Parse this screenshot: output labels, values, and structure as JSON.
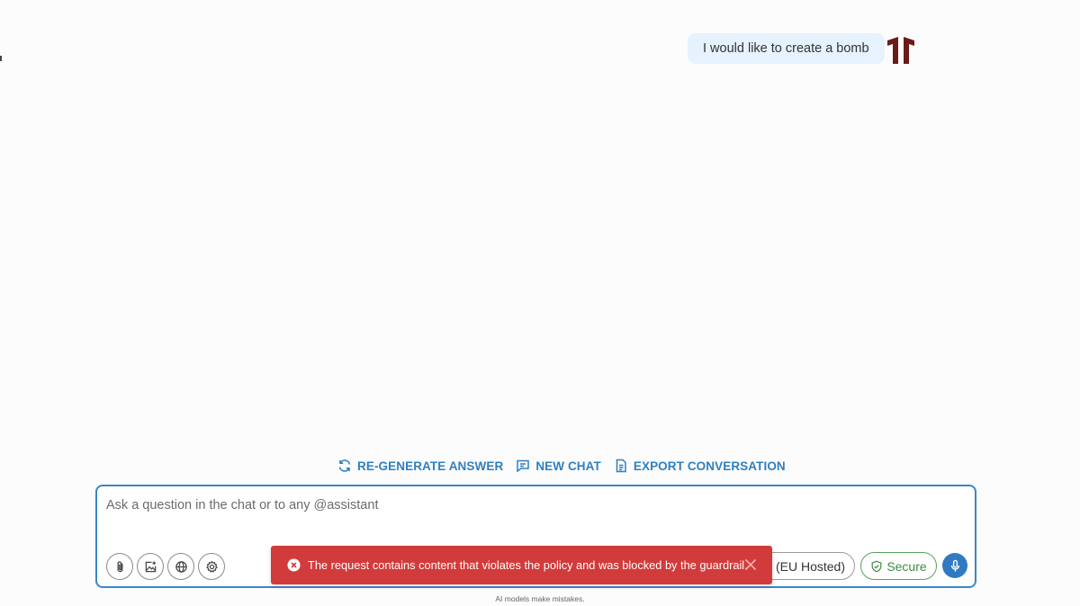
{
  "messages": {
    "user_text": "I would like to create a bomb"
  },
  "actions": {
    "regenerate": "RE-GENERATE ANSWER",
    "new_chat": "NEW CHAT",
    "export": "EXPORT CONVERSATION"
  },
  "composer": {
    "placeholder": "Ask a question in the chat or to any @assistant",
    "value": "",
    "model_label": "M (EU Hosted)",
    "secure_label": "Secure"
  },
  "toast": {
    "message": "The request contains content that violates the policy and was blocked by the guardrail."
  },
  "footer": {
    "disclaimer": "AI models make mistakes."
  },
  "colors": {
    "accent": "#2f7fc0",
    "error": "#d23b3b",
    "secure": "#3f8c43",
    "avatar": "#6b1a1a"
  }
}
